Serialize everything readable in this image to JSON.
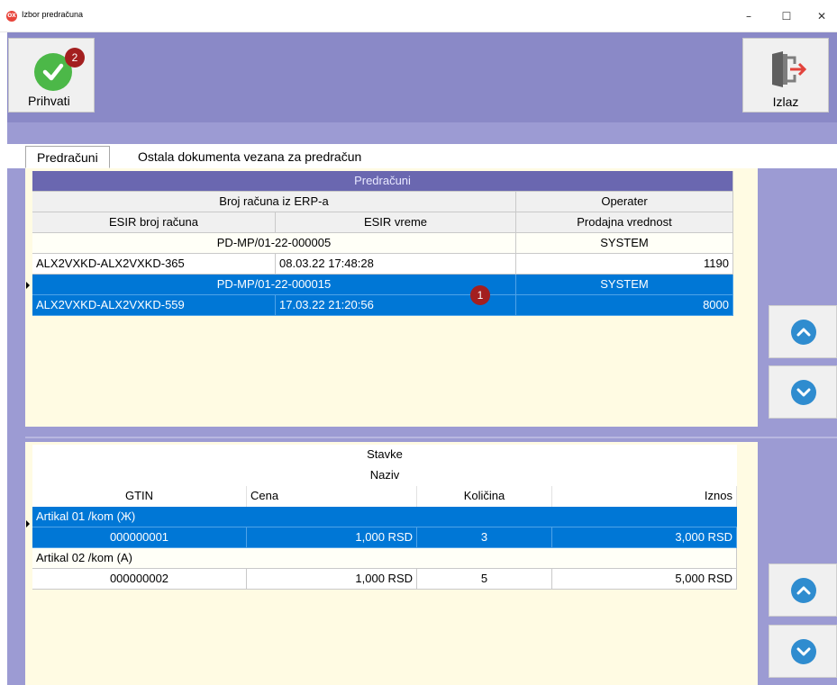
{
  "window": {
    "title": "Izbor predračuna",
    "icon_label": "OX",
    "minimize": "–",
    "maximize": "☐",
    "close": "✕"
  },
  "toolbar": {
    "accept_label": "Prihvati",
    "accept_badge": "2",
    "exit_label": "Izlaz"
  },
  "tabs": [
    {
      "label": "Predračuni",
      "active": true
    },
    {
      "label": "Ostala dokumenta vezana za predračun",
      "active": false
    }
  ],
  "top_grid": {
    "band_title": "Predračuni",
    "header_row1": [
      "Broj računa iz ERP-a",
      "Operater"
    ],
    "header_row2": [
      "ESIR broj računa",
      "ESIR vreme",
      "Prodajna vrednost"
    ],
    "records": [
      {
        "broj_racuna": "PD-MP/01-22-000005",
        "operater": "SYSTEM",
        "esir_broj": "ALX2VXKD-ALX2VXKD-365",
        "esir_vreme": "08.03.22 17:48:28",
        "vrednost": "1190",
        "selected": false
      },
      {
        "broj_racuna": "PD-MP/01-22-000015",
        "operater": "SYSTEM",
        "esir_broj": "ALX2VXKD-ALX2VXKD-559",
        "esir_vreme": "17.03.22 21:20:56",
        "vrednost": "8000",
        "selected": true,
        "badge": "1"
      }
    ]
  },
  "bottom_grid": {
    "band_title": "Stavke",
    "sub_title": "Naziv",
    "columns": [
      "GTIN",
      "Cena",
      "Količina",
      "Iznos"
    ],
    "items": [
      {
        "naziv": "Artikal 01 /kom (Ж)",
        "gtin": "000000001",
        "cena": "1,000 RSD",
        "kolicina": "3",
        "iznos": "3,000 RSD",
        "selected": true
      },
      {
        "naziv": "Artikal 02 /kom (A)",
        "gtin": "000000002",
        "cena": "1,000 RSD",
        "kolicina": "5",
        "iznos": "5,000 RSD",
        "selected": false
      }
    ]
  },
  "colors": {
    "toolbar_bg": "#8a89c7",
    "panel_bg": "#9c9bd3",
    "grid_bg": "#fffbe3",
    "selection": "#0077d6",
    "accept_green": "#4cb848",
    "badge_red": "#a31f1f",
    "nav_blue": "#2f8ccf"
  },
  "icons": {
    "accept": "check-circle-icon",
    "exit": "door-exit-icon",
    "scroll_up": "chevron-up-icon",
    "scroll_down": "chevron-down-icon"
  }
}
